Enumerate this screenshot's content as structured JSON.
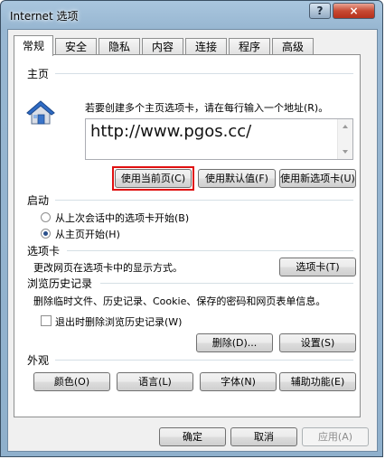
{
  "window": {
    "title": "Internet 选项",
    "help": "?",
    "close": "×"
  },
  "tabs": [
    "常规",
    "安全",
    "隐私",
    "内容",
    "连接",
    "程序",
    "高级"
  ],
  "home": {
    "label": "主页",
    "desc": "若要创建多个主页选项卡，请在每行输入一个地址(R)。",
    "url": "http://www.pgos.cc/",
    "btn_current": "使用当前页(C)",
    "btn_default": "使用默认值(F)",
    "btn_blank": "使用新选项卡(U)"
  },
  "startup": {
    "label": "启动",
    "option1": "从上次会话中的选项卡开始(B)",
    "option2": "从主页开始(H)",
    "selected": "option2"
  },
  "tabs_group": {
    "label": "选项卡",
    "desc": "更改网页在选项卡中的显示方式。",
    "btn": "选项卡(T)"
  },
  "history": {
    "label": "浏览历史记录",
    "desc": "删除临时文件、历史记录、Cookie、保存的密码和网页表单信息。",
    "checkbox": "退出时删除浏览历史记录(W)",
    "btn_delete": "删除(D)...",
    "btn_settings": "设置(S)"
  },
  "appearance": {
    "label": "外观",
    "btn_colors": "颜色(O)",
    "btn_languages": "语言(L)",
    "btn_fonts": "字体(N)",
    "btn_accessibility": "辅助功能(E)"
  },
  "footer": {
    "ok": "确定",
    "cancel": "取消",
    "apply": "应用(A)"
  },
  "colors": {
    "highlight": "#e01010",
    "titlebar": "#a9c6de",
    "close": "#c74a33"
  }
}
